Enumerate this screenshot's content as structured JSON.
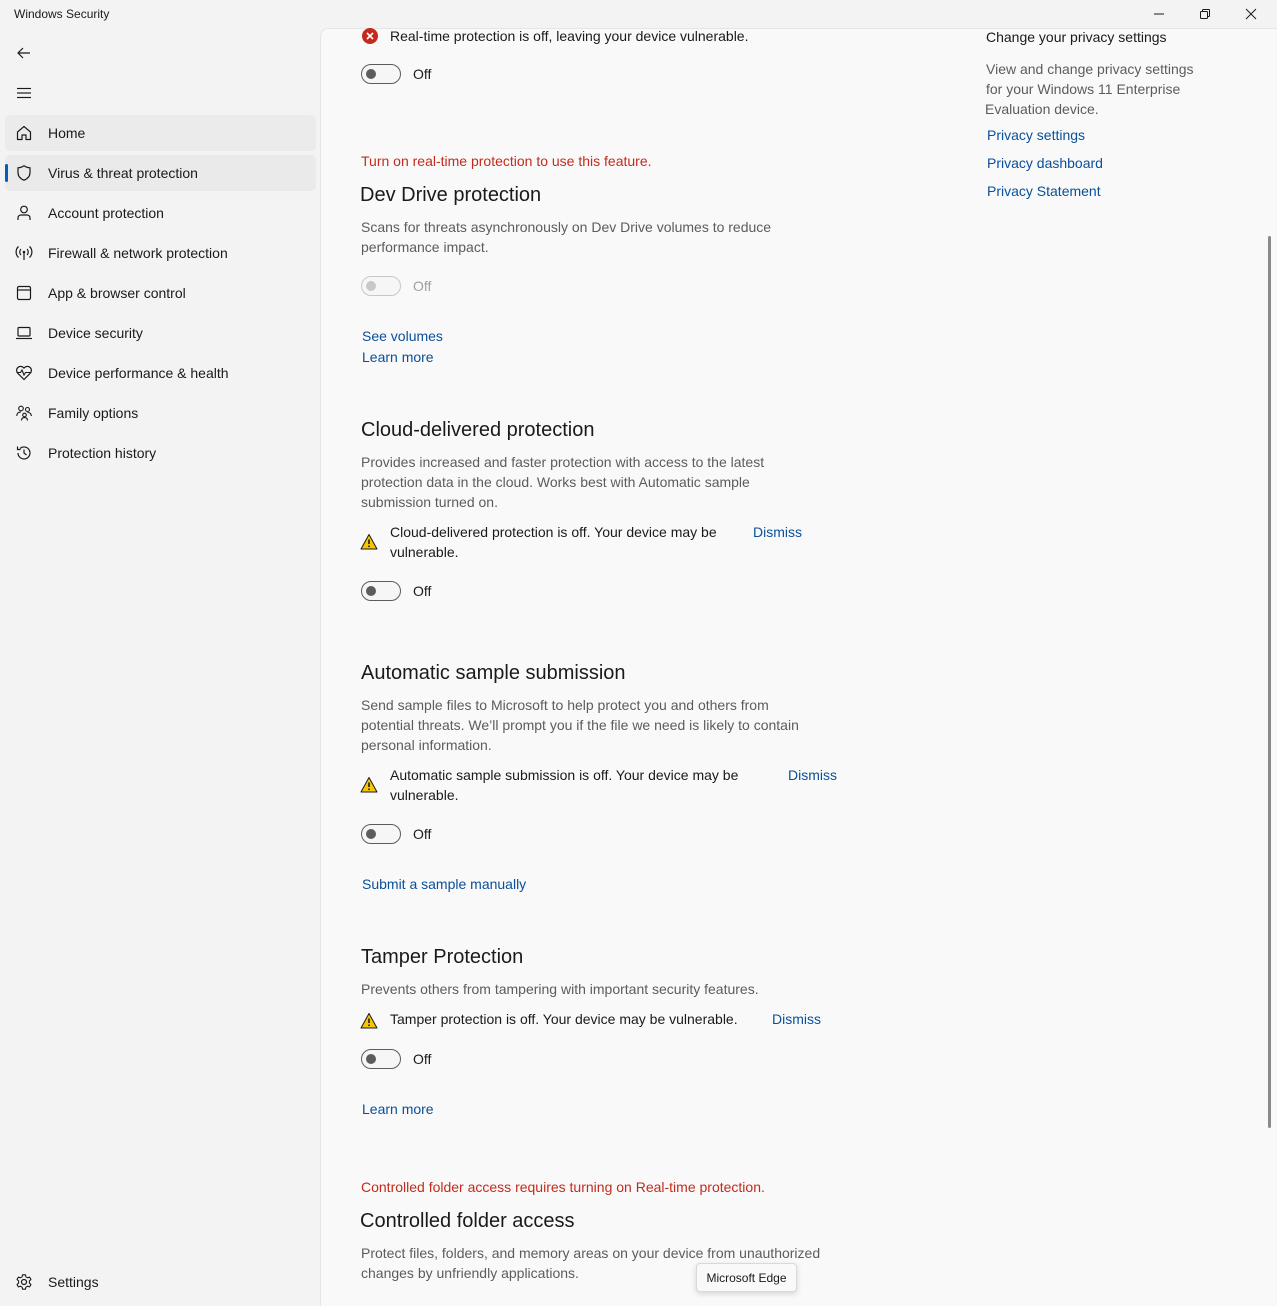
{
  "window": {
    "title": "Windows Security",
    "minimize_label": "Minimize",
    "restore_label": "Restore",
    "close_label": "Close"
  },
  "sidebar": {
    "items": [
      {
        "label": "Home",
        "icon": "home-icon"
      },
      {
        "label": "Virus & threat protection",
        "icon": "shield-icon"
      },
      {
        "label": "Account protection",
        "icon": "person-icon"
      },
      {
        "label": "Firewall & network protection",
        "icon": "wireless-icon"
      },
      {
        "label": "App & browser control",
        "icon": "app-window-icon"
      },
      {
        "label": "Device security",
        "icon": "laptop-icon"
      },
      {
        "label": "Device performance & health",
        "icon": "heart-pulse-icon"
      },
      {
        "label": "Family options",
        "icon": "family-icon"
      },
      {
        "label": "Protection history",
        "icon": "history-icon"
      }
    ],
    "settings_label": "Settings"
  },
  "realtime": {
    "status_text": "Real-time protection is off, leaving your device vulnerable.",
    "toggle_label": "Off"
  },
  "dev_drive": {
    "requirement": "Turn on real-time protection to use this feature.",
    "title": "Dev Drive protection",
    "description_line1": "Scans for threats asynchronously on Dev Drive volumes to reduce",
    "description_line2": "performance impact.",
    "toggle_label": "Off",
    "link_volumes": "See volumes",
    "link_learn": "Learn more"
  },
  "cloud": {
    "title": "Cloud-delivered protection",
    "description_line1": "Provides increased and faster protection with access to the latest",
    "description_line2": "protection data in the cloud. Works best with Automatic sample",
    "description_line3": "submission turned on.",
    "warning_line1": "Cloud-delivered protection is off. Your device may be",
    "warning_line2": "vulnerable.",
    "dismiss": "Dismiss",
    "toggle_label": "Off"
  },
  "sample": {
    "title": "Automatic sample submission",
    "description_line1": "Send sample files to Microsoft to help protect you and others from",
    "description_line2": "potential threats. We’ll prompt you if the file we need is likely to contain",
    "description_line3": "personal information.",
    "warning_line1": "Automatic sample submission is off. Your device may be",
    "warning_line2": "vulnerable.",
    "dismiss": "Dismiss",
    "toggle_label": "Off",
    "link_submit": "Submit a sample manually"
  },
  "tamper": {
    "title": "Tamper Protection",
    "description": "Prevents others from tampering with important security features.",
    "warning": "Tamper protection is off. Your device may be vulnerable.",
    "dismiss": "Dismiss",
    "toggle_label": "Off",
    "link_learn": "Learn more"
  },
  "cfa": {
    "requirement": "Controlled folder access requires turning on Real-time protection.",
    "title": "Controlled folder access",
    "description_line1": "Protect files, folders, and memory areas on your device from unauthorized",
    "description_line2": "changes by unfriendly applications."
  },
  "privacy": {
    "title": "Change your privacy settings",
    "description_line1": "View and change privacy settings",
    "description_line2": "for your Windows 11 Enterprise",
    "description_line3": "Evaluation device.",
    "links": [
      "Privacy settings",
      "Privacy dashboard",
      "Privacy Statement"
    ]
  },
  "tooltip": {
    "text": "Microsoft Edge"
  },
  "colors": {
    "accent": "#005fb8",
    "link": "#0a4f9a",
    "error": "#c42b1c",
    "warning": "#f7c600"
  }
}
